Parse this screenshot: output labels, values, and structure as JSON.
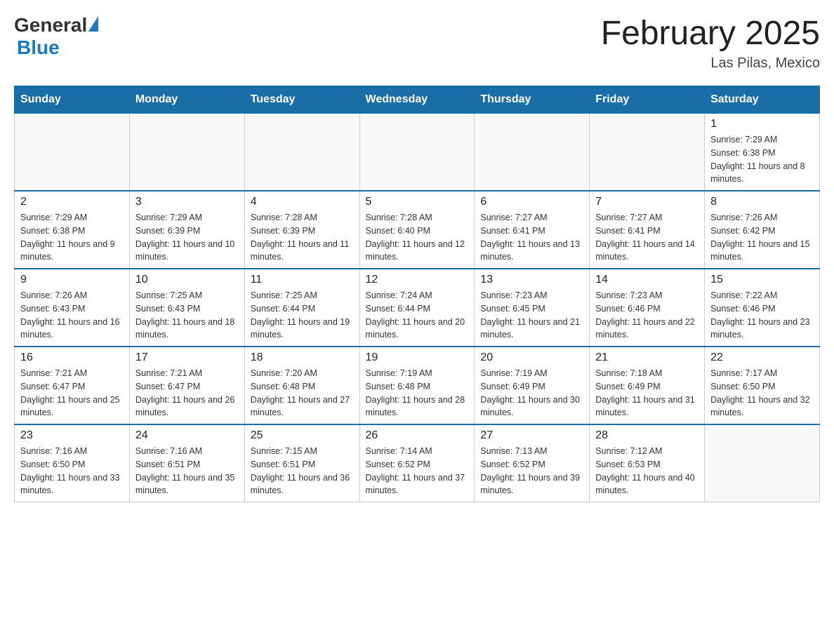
{
  "header": {
    "logo": {
      "general": "General",
      "blue": "Blue"
    },
    "title": "February 2025",
    "location": "Las Pilas, Mexico"
  },
  "weekdays": [
    "Sunday",
    "Monday",
    "Tuesday",
    "Wednesday",
    "Thursday",
    "Friday",
    "Saturday"
  ],
  "weeks": [
    [
      {
        "day": "",
        "info": ""
      },
      {
        "day": "",
        "info": ""
      },
      {
        "day": "",
        "info": ""
      },
      {
        "day": "",
        "info": ""
      },
      {
        "day": "",
        "info": ""
      },
      {
        "day": "",
        "info": ""
      },
      {
        "day": "1",
        "info": "Sunrise: 7:29 AM\nSunset: 6:38 PM\nDaylight: 11 hours and 8 minutes."
      }
    ],
    [
      {
        "day": "2",
        "info": "Sunrise: 7:29 AM\nSunset: 6:38 PM\nDaylight: 11 hours and 9 minutes."
      },
      {
        "day": "3",
        "info": "Sunrise: 7:29 AM\nSunset: 6:39 PM\nDaylight: 11 hours and 10 minutes."
      },
      {
        "day": "4",
        "info": "Sunrise: 7:28 AM\nSunset: 6:39 PM\nDaylight: 11 hours and 11 minutes."
      },
      {
        "day": "5",
        "info": "Sunrise: 7:28 AM\nSunset: 6:40 PM\nDaylight: 11 hours and 12 minutes."
      },
      {
        "day": "6",
        "info": "Sunrise: 7:27 AM\nSunset: 6:41 PM\nDaylight: 11 hours and 13 minutes."
      },
      {
        "day": "7",
        "info": "Sunrise: 7:27 AM\nSunset: 6:41 PM\nDaylight: 11 hours and 14 minutes."
      },
      {
        "day": "8",
        "info": "Sunrise: 7:26 AM\nSunset: 6:42 PM\nDaylight: 11 hours and 15 minutes."
      }
    ],
    [
      {
        "day": "9",
        "info": "Sunrise: 7:26 AM\nSunset: 6:43 PM\nDaylight: 11 hours and 16 minutes."
      },
      {
        "day": "10",
        "info": "Sunrise: 7:25 AM\nSunset: 6:43 PM\nDaylight: 11 hours and 18 minutes."
      },
      {
        "day": "11",
        "info": "Sunrise: 7:25 AM\nSunset: 6:44 PM\nDaylight: 11 hours and 19 minutes."
      },
      {
        "day": "12",
        "info": "Sunrise: 7:24 AM\nSunset: 6:44 PM\nDaylight: 11 hours and 20 minutes."
      },
      {
        "day": "13",
        "info": "Sunrise: 7:23 AM\nSunset: 6:45 PM\nDaylight: 11 hours and 21 minutes."
      },
      {
        "day": "14",
        "info": "Sunrise: 7:23 AM\nSunset: 6:46 PM\nDaylight: 11 hours and 22 minutes."
      },
      {
        "day": "15",
        "info": "Sunrise: 7:22 AM\nSunset: 6:46 PM\nDaylight: 11 hours and 23 minutes."
      }
    ],
    [
      {
        "day": "16",
        "info": "Sunrise: 7:21 AM\nSunset: 6:47 PM\nDaylight: 11 hours and 25 minutes."
      },
      {
        "day": "17",
        "info": "Sunrise: 7:21 AM\nSunset: 6:47 PM\nDaylight: 11 hours and 26 minutes."
      },
      {
        "day": "18",
        "info": "Sunrise: 7:20 AM\nSunset: 6:48 PM\nDaylight: 11 hours and 27 minutes."
      },
      {
        "day": "19",
        "info": "Sunrise: 7:19 AM\nSunset: 6:48 PM\nDaylight: 11 hours and 28 minutes."
      },
      {
        "day": "20",
        "info": "Sunrise: 7:19 AM\nSunset: 6:49 PM\nDaylight: 11 hours and 30 minutes."
      },
      {
        "day": "21",
        "info": "Sunrise: 7:18 AM\nSunset: 6:49 PM\nDaylight: 11 hours and 31 minutes."
      },
      {
        "day": "22",
        "info": "Sunrise: 7:17 AM\nSunset: 6:50 PM\nDaylight: 11 hours and 32 minutes."
      }
    ],
    [
      {
        "day": "23",
        "info": "Sunrise: 7:16 AM\nSunset: 6:50 PM\nDaylight: 11 hours and 33 minutes."
      },
      {
        "day": "24",
        "info": "Sunrise: 7:16 AM\nSunset: 6:51 PM\nDaylight: 11 hours and 35 minutes."
      },
      {
        "day": "25",
        "info": "Sunrise: 7:15 AM\nSunset: 6:51 PM\nDaylight: 11 hours and 36 minutes."
      },
      {
        "day": "26",
        "info": "Sunrise: 7:14 AM\nSunset: 6:52 PM\nDaylight: 11 hours and 37 minutes."
      },
      {
        "day": "27",
        "info": "Sunrise: 7:13 AM\nSunset: 6:52 PM\nDaylight: 11 hours and 39 minutes."
      },
      {
        "day": "28",
        "info": "Sunrise: 7:12 AM\nSunset: 6:53 PM\nDaylight: 11 hours and 40 minutes."
      },
      {
        "day": "",
        "info": ""
      }
    ]
  ]
}
